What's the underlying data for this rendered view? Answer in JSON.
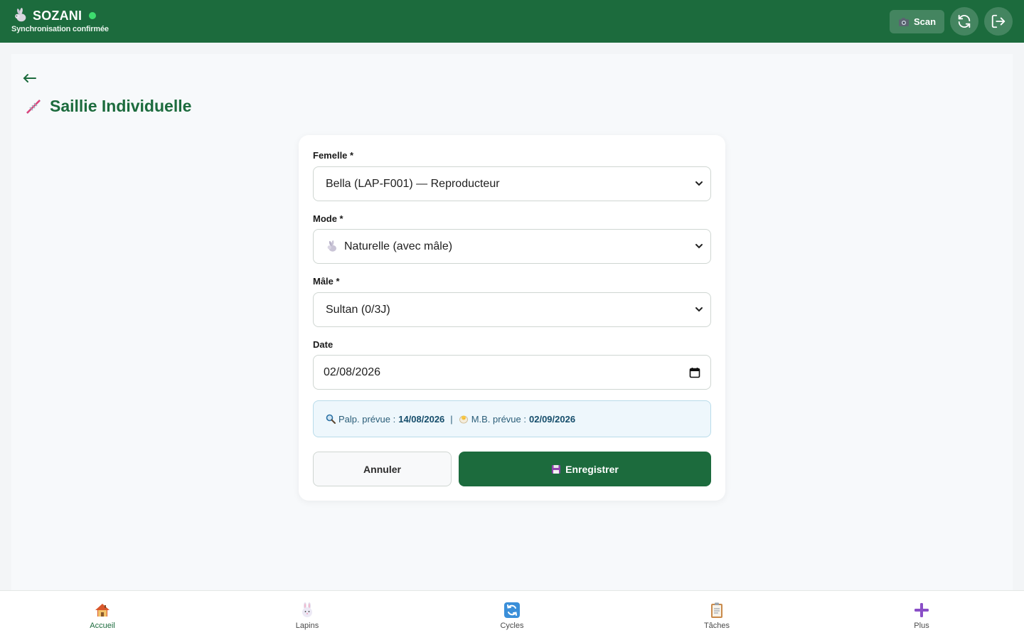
{
  "app": {
    "name": "SOZANI",
    "sync_status": "Synchronisation confirmée"
  },
  "header": {
    "scan_label": "Scan"
  },
  "page": {
    "title": "Saillie Individuelle"
  },
  "form": {
    "femelle": {
      "label": "Femelle *",
      "value": "Bella (LAP-F001) — Reproducteur"
    },
    "mode": {
      "label": "Mode *",
      "value": "Naturelle (avec mâle)"
    },
    "male": {
      "label": "Mâle *",
      "value": "Sultan (0/3J)"
    },
    "date": {
      "label": "Date",
      "value": "02/08/2026"
    },
    "forecast": {
      "palp_label": "Palp. prévue :",
      "palp_date": "14/08/2026",
      "separator": "|",
      "mb_label": "M.B. prévue :",
      "mb_date": "02/09/2026"
    },
    "cancel_label": "Annuler",
    "save_label": "Enregistrer"
  },
  "nav": {
    "items": [
      {
        "label": "Accueil",
        "icon": "house-icon",
        "active": true
      },
      {
        "label": "Lapins",
        "icon": "rabbit-icon",
        "active": false
      },
      {
        "label": "Cycles",
        "icon": "cycle-icon",
        "active": false
      },
      {
        "label": "Tâches",
        "icon": "clipboard-icon",
        "active": false
      },
      {
        "label": "Plus",
        "icon": "plus-icon",
        "active": false
      }
    ]
  },
  "colors": {
    "primary": "#1c6b3d",
    "online": "#3ddc6e",
    "info_bg": "#eef7fc",
    "info_border": "#b9dcea"
  }
}
